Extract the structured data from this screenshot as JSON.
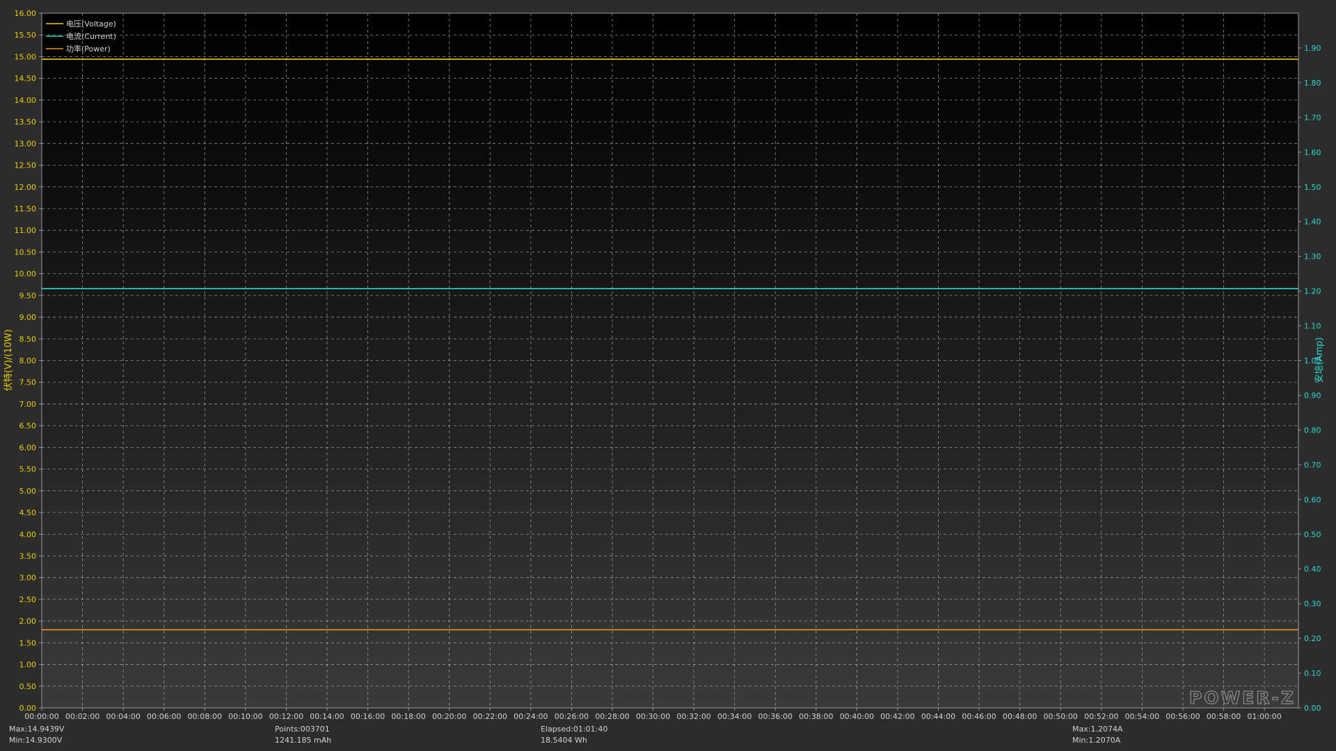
{
  "chart_data": {
    "type": "line",
    "ylabel_left": "伏特(V)/(10W)",
    "ylabel_right": "安培(Amp)",
    "ylim_left": [
      0,
      16
    ],
    "ylim_right": [
      0,
      2.0
    ],
    "yticks_left": [
      "0.00",
      "0.50",
      "1.00",
      "1.50",
      "2.00",
      "2.50",
      "3.00",
      "3.50",
      "4.00",
      "4.50",
      "5.00",
      "5.50",
      "6.00",
      "6.50",
      "7.00",
      "7.50",
      "8.00",
      "8.50",
      "9.00",
      "9.50",
      "10.00",
      "10.50",
      "11.00",
      "11.50",
      "12.00",
      "12.50",
      "13.00",
      "13.50",
      "14.00",
      "14.50",
      "15.00",
      "15.50",
      "16.00"
    ],
    "yticks_right": [
      "0.00",
      "0.10",
      "0.20",
      "0.30",
      "0.40",
      "0.50",
      "0.60",
      "0.70",
      "0.80",
      "0.90",
      "1.00",
      "1.10",
      "1.20",
      "1.30",
      "1.40",
      "1.50",
      "1.60",
      "1.70",
      "1.80",
      "1.90"
    ],
    "xticks": [
      "00:00:00",
      "00:02:00",
      "00:04:00",
      "00:06:00",
      "00:08:00",
      "00:10:00",
      "00:12:00",
      "00:14:00",
      "00:16:00",
      "00:18:00",
      "00:20:00",
      "00:22:00",
      "00:24:00",
      "00:26:00",
      "00:28:00",
      "00:30:00",
      "00:32:00",
      "00:34:00",
      "00:36:00",
      "00:38:00",
      "00:40:00",
      "00:42:00",
      "00:44:00",
      "00:46:00",
      "00:48:00",
      "00:50:00",
      "00:52:00",
      "00:54:00",
      "00:56:00",
      "00:58:00",
      "01:00:00"
    ],
    "xlim_minutes": [
      0,
      61.67
    ],
    "grid": true,
    "legend_position": "top-left",
    "series": [
      {
        "name": "电压(Voltage)",
        "axis": "left",
        "color": "#e8d000",
        "x_minutes": [
          0,
          61.67
        ],
        "values": [
          14.94,
          14.94
        ]
      },
      {
        "name": "电流(Current)",
        "axis": "right",
        "color": "#30d8d0",
        "x_minutes": [
          0,
          61.67
        ],
        "values": [
          1.207,
          1.207
        ]
      },
      {
        "name": "功率(Power)",
        "axis": "left",
        "color": "#f09020",
        "x_minutes": [
          0,
          61.67
        ],
        "values": [
          1.8,
          1.8
        ]
      }
    ]
  },
  "brand": "POWER-Z",
  "stats": {
    "voltage_max": "Max:14.9439V",
    "voltage_min": "Min:14.9300V",
    "points": "Points:003701",
    "capacity": "1241.185 mAh",
    "elapsed": "Elapsed:01:01:40",
    "energy": "18.5404 Wh",
    "current_max": "Max:1.2074A",
    "current_min": "Min:1.2070A"
  },
  "colors": {
    "voltage": "#e8d000",
    "current": "#30d8d0",
    "power": "#f09020",
    "grid": "#c8c8c8"
  }
}
